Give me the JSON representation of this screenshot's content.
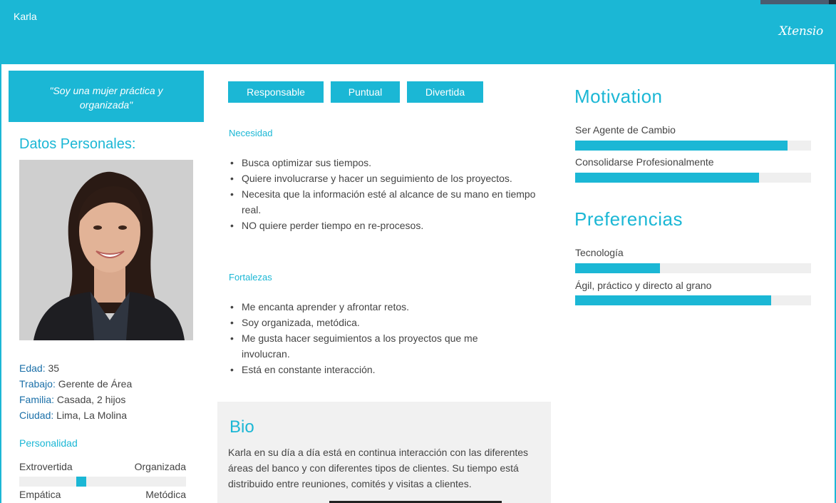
{
  "header": {
    "name": "Karla",
    "logo": "Xtensio"
  },
  "left": {
    "quote": "\"Soy una mujer práctica y organizada\"",
    "section_title": "Datos Personales:",
    "details": [
      {
        "label": "Edad:",
        "value": " 35"
      },
      {
        "label": "Trabajo:",
        "value": " Gerente de Área"
      },
      {
        "label": "Familia:",
        "value": " Casada, 2 hijos"
      },
      {
        "label": "Ciudad:",
        "value": " Lima, La Molina"
      }
    ],
    "personality_title": "Personalidad",
    "traits": [
      {
        "left": "Extrovertida",
        "right": "Organizada",
        "position": 0.37
      },
      {
        "left": "Empática",
        "right": "Metódica"
      }
    ]
  },
  "middle": {
    "tags": [
      "Responsable",
      "Puntual",
      "Divertida"
    ],
    "needs_title": "Necesidad",
    "needs": [
      "Busca optimizar sus tiempos.",
      "Quiere involucrarse y hacer un seguimiento de los proyectos.",
      "Necesita que la información esté al alcance de su mano en tiempo real.",
      "NO quiere perder tiempo en re-procesos."
    ],
    "strengths_title": "Fortalezas",
    "strengths": [
      "Me encanta aprender y afrontar retos.",
      "Soy organizada, metódica.",
      "Me gusta hacer seguimientos a los proyectos que me involucran.",
      "Está en constante interacción."
    ],
    "bio_title": "Bio",
    "bio_text": "Karla en su día a día  está en continua interacción con las diferentes áreas del banco y con diferentes tipos de clientes. Su tiempo está distribuido entre reuniones, comités y visitas a clientes."
  },
  "right": {
    "motivation_title": "Motivation",
    "motivations": [
      {
        "label": "Ser Agente de Cambio",
        "level": 0.9
      },
      {
        "label": "Consolidarse Profesionalmente",
        "level": 0.78
      }
    ],
    "preferences_title": "Preferencias",
    "preferences": [
      {
        "label": "Tecnología",
        "level": 0.36
      },
      {
        "label": "Ágil, práctico y directo al grano",
        "level": 0.83
      }
    ]
  },
  "colors": {
    "accent": "#1bb7d5",
    "label_blue": "#1a6fa8",
    "track": "#efefef",
    "bio_bg": "#f1f1f1"
  }
}
